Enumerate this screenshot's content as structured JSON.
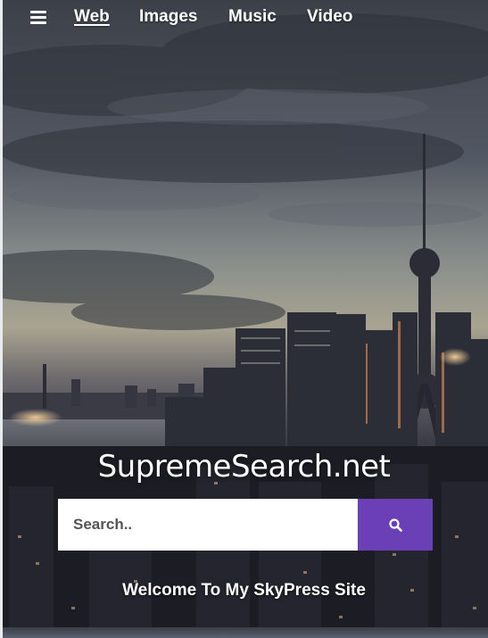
{
  "nav": {
    "items": [
      {
        "label": "Web",
        "active": true
      },
      {
        "label": "Images",
        "active": false
      },
      {
        "label": "Music",
        "active": false
      },
      {
        "label": "Video",
        "active": false
      }
    ],
    "menu_icon": "hamburger-menu-icon"
  },
  "logo": {
    "text": "SupremeSearch.net"
  },
  "search": {
    "placeholder": "Search..",
    "value": "",
    "button_icon": "search-icon",
    "button_color": "#6b3fb6"
  },
  "tagline": {
    "text": "Welcome To My SkyPress Site"
  },
  "colors": {
    "accent": "#6b3fb6",
    "text": "#ffffff"
  }
}
